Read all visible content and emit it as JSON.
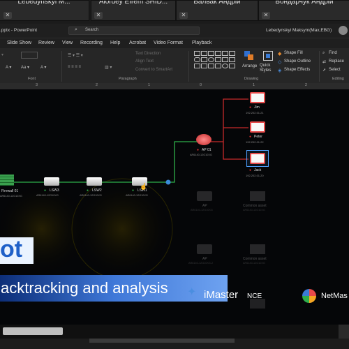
{
  "participants": [
    {
      "name": "Lebedynskyi M..."
    },
    {
      "name": "Alordey Efrem SHID..."
    },
    {
      "name": "Балвак Андрій"
    },
    {
      "name": "Бондарчук Андрій"
    }
  ],
  "titlebar": {
    "app": ".pptx - PowerPoint",
    "search_placeholder": "Search",
    "user": "Lebedynskyi Maksym(Max,EBG)"
  },
  "tabs": [
    "Slide Show",
    "Review",
    "View",
    "Recording",
    "Help",
    "Acrobat",
    "Video Format",
    "Playback"
  ],
  "ribbon": {
    "text_direction": "Text Direction",
    "align_text": "Align Text",
    "convert_smartart": "Convert to SmartArt",
    "arrange": "Arrange",
    "quick_styles": "Quick Styles",
    "shape_fill": "Shape Fill",
    "shape_outline": "Shape Outline",
    "shape_effects": "Shape Effects",
    "find": "Find",
    "replace": "Replace",
    "select": "Select",
    "groups": {
      "font": "Font",
      "paragraph": "Paragraph",
      "drawing": "Drawing",
      "editing": "Editing"
    }
  },
  "ruler": {
    "ticks": [
      "3",
      "2",
      "1",
      "0",
      "1",
      "2"
    ]
  },
  "slide": {
    "clients": [
      {
        "name": "Jim",
        "ip": "192.202.01.21"
      },
      {
        "name": "Peter",
        "ip": "192.202.01.22"
      },
      {
        "name": "Jack",
        "ip": "192.202.01.20"
      }
    ],
    "ap": {
      "name": "AP 01",
      "model": "AR6140-12G10XG"
    },
    "switches": [
      {
        "name": "LSW3",
        "model": "AR6140-12G10XG"
      },
      {
        "name": "LSW2",
        "model": "AR6140-12G10XG"
      },
      {
        "name": "LSW1",
        "model": "AR6140-12G10XG"
      }
    ],
    "firewall": {
      "name": "Firewall 01",
      "model": "AR6140-12G10XG"
    },
    "faded_nodes": [
      {
        "name": "AP",
        "sub": "AR6140-12G10XG"
      },
      {
        "name": "Common asset",
        "sub": "AR6140-12G10XG"
      },
      {
        "name": "AP",
        "sub": "AR6140-12G10XG-2"
      },
      {
        "name": "Common asset",
        "sub": "AR6140-12G10XG"
      }
    ],
    "banner_fragment": "ot",
    "banner_text": "acktracking and analysis",
    "logo_imaster": "iMaster",
    "logo_nce": "NCE",
    "logo_netmaster": "NetMas"
  }
}
